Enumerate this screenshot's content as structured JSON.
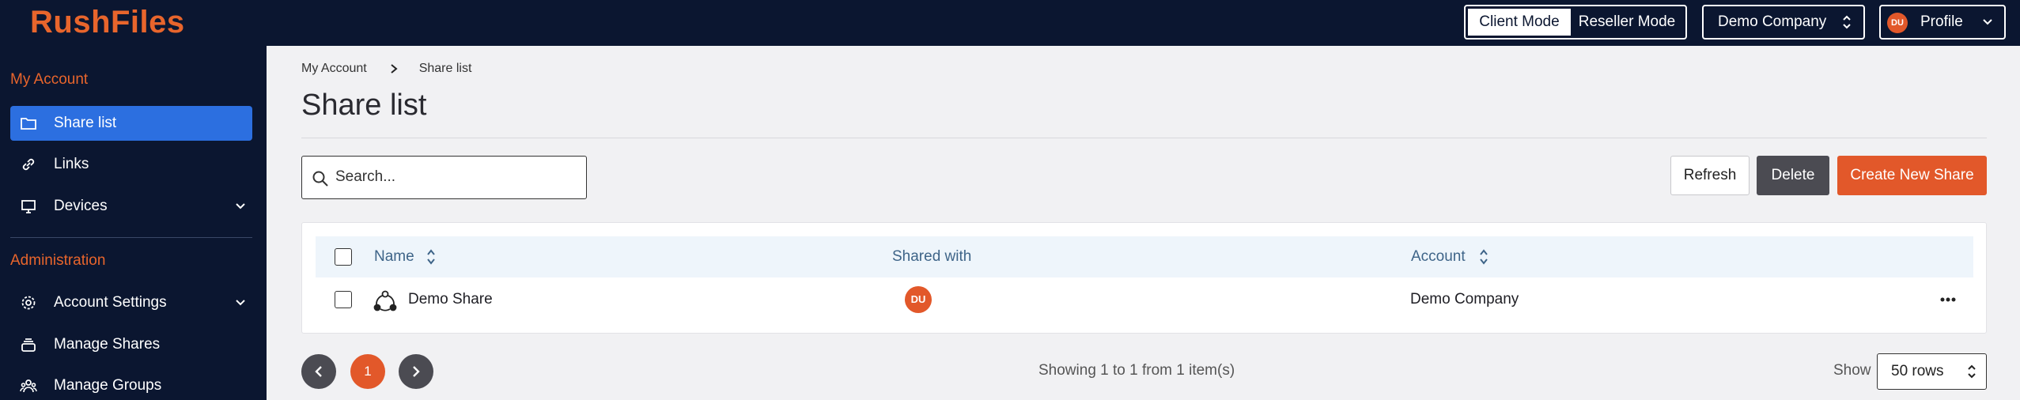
{
  "app": {
    "logo": "RushFiles"
  },
  "topbar": {
    "modes": [
      "Client Mode",
      "Reseller Mode"
    ],
    "active_mode": "Client Mode",
    "company": "Demo Company",
    "profile": {
      "initials": "DU",
      "label": "Profile"
    }
  },
  "sidebar": {
    "sections": [
      {
        "title": "My Account",
        "items": [
          {
            "label": "Share list",
            "icon": "folder-icon",
            "active": true
          },
          {
            "label": "Links",
            "icon": "link-icon"
          },
          {
            "label": "Devices",
            "icon": "monitor-icon",
            "expandable": true
          }
        ]
      },
      {
        "title": "Administration",
        "items": [
          {
            "label": "Account Settings",
            "icon": "gear-icon",
            "expandable": true
          },
          {
            "label": "Manage Shares",
            "icon": "stack-icon"
          },
          {
            "label": "Manage Groups",
            "icon": "users-icon"
          }
        ]
      }
    ]
  },
  "breadcrumb": [
    "My Account",
    "Share list"
  ],
  "page": {
    "title": "Share list"
  },
  "search": {
    "placeholder": "Search..."
  },
  "actions": {
    "refresh": "Refresh",
    "delete": "Delete",
    "create": "Create New Share"
  },
  "table": {
    "columns": [
      "Name",
      "Shared with",
      "Account"
    ],
    "rows": [
      {
        "name": "Demo Share",
        "shared_with_initials": "DU",
        "account": "Demo Company"
      }
    ]
  },
  "pagination": {
    "current_page": "1",
    "summary": "Showing 1 to 1 from 1 item(s)",
    "show_label": "Show",
    "rows_option": "50 rows"
  },
  "colors": {
    "accent": "#e2582a",
    "nav_bg": "#0b1630",
    "active_blue": "#2c6fe0"
  }
}
